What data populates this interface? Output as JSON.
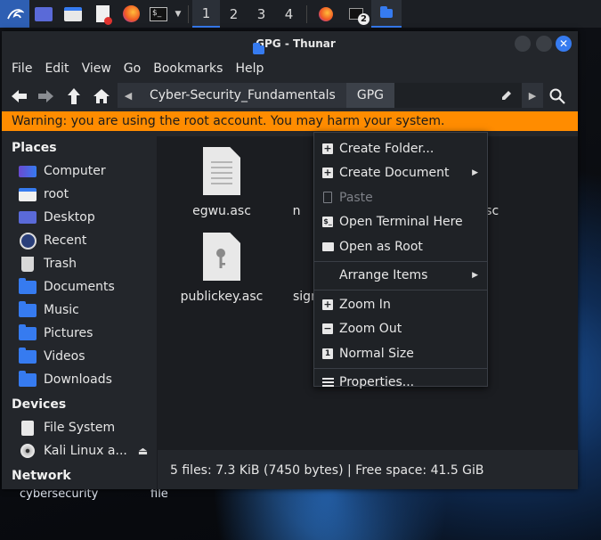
{
  "panel": {
    "workspaces": [
      "1",
      "2",
      "3",
      "4"
    ],
    "active_workspace": "1",
    "terminal_badge": "2"
  },
  "window": {
    "title": "GPG - Thunar",
    "menu": [
      "File",
      "Edit",
      "View",
      "Go",
      "Bookmarks",
      "Help"
    ],
    "path": [
      "Cyber-Security_Fundamentals",
      "GPG"
    ],
    "warning": "Warning: you are using the root account. You may harm your system."
  },
  "sidebar": {
    "places_heading": "Places",
    "places": [
      {
        "label": "Computer",
        "icon": "computer-icon"
      },
      {
        "label": "root",
        "icon": "home-folder-icon"
      },
      {
        "label": "Desktop",
        "icon": "desktop-folder-icon"
      },
      {
        "label": "Recent",
        "icon": "recent-clock-icon"
      },
      {
        "label": "Trash",
        "icon": "trash-icon"
      },
      {
        "label": "Documents",
        "icon": "documents-folder-icon"
      },
      {
        "label": "Music",
        "icon": "music-folder-icon"
      },
      {
        "label": "Pictures",
        "icon": "pictures-folder-icon"
      },
      {
        "label": "Videos",
        "icon": "videos-folder-icon"
      },
      {
        "label": "Downloads",
        "icon": "downloads-folder-icon"
      }
    ],
    "devices_heading": "Devices",
    "devices": [
      {
        "label": "File System",
        "icon": "drive-icon"
      },
      {
        "label": "Kali Linux a...",
        "icon": "optical-disc-icon"
      }
    ],
    "network_heading": "Network"
  },
  "files": [
    {
      "name": "egwu.asc",
      "icon": "text-file-icon"
    },
    {
      "name": "n",
      "icon": "text-file-icon"
    },
    {
      "name": "y.asc",
      "icon": "text-file-icon"
    },
    {
      "name": "publickey.asc",
      "icon": "key-file-icon"
    },
    {
      "name": "sign",
      "icon": "text-file-icon"
    }
  ],
  "status": "5 files: 7.3 KiB (7450 bytes)  |  Free space: 41.5 GiB",
  "context_menu": [
    {
      "label": "Create Folder...",
      "icon": "plus-icon",
      "enabled": true,
      "submenu": false
    },
    {
      "label": "Create Document",
      "icon": "plus-icon",
      "enabled": true,
      "submenu": true
    },
    {
      "label": "Paste",
      "icon": "clipboard-icon",
      "enabled": false,
      "submenu": false
    },
    {
      "label": "Open Terminal Here",
      "icon": "terminal-icon",
      "enabled": true,
      "submenu": false
    },
    {
      "label": "Open as Root",
      "icon": "folder-icon",
      "enabled": true,
      "submenu": false
    },
    {
      "label": "Arrange Items",
      "icon": "",
      "enabled": true,
      "submenu": true
    },
    {
      "label": "Zoom In",
      "icon": "zoom-in-icon",
      "enabled": true,
      "submenu": false
    },
    {
      "label": "Zoom Out",
      "icon": "zoom-out-icon",
      "enabled": true,
      "submenu": false
    },
    {
      "label": "Normal Size",
      "icon": "normal-size-icon",
      "enabled": true,
      "submenu": false
    },
    {
      "label": "Properties...",
      "icon": "properties-icon",
      "enabled": true,
      "submenu": false
    }
  ],
  "desktop_icons": [
    "cybersecurity",
    "file"
  ],
  "colors": {
    "accent": "#367bf0",
    "warning": "#ff8c00"
  }
}
